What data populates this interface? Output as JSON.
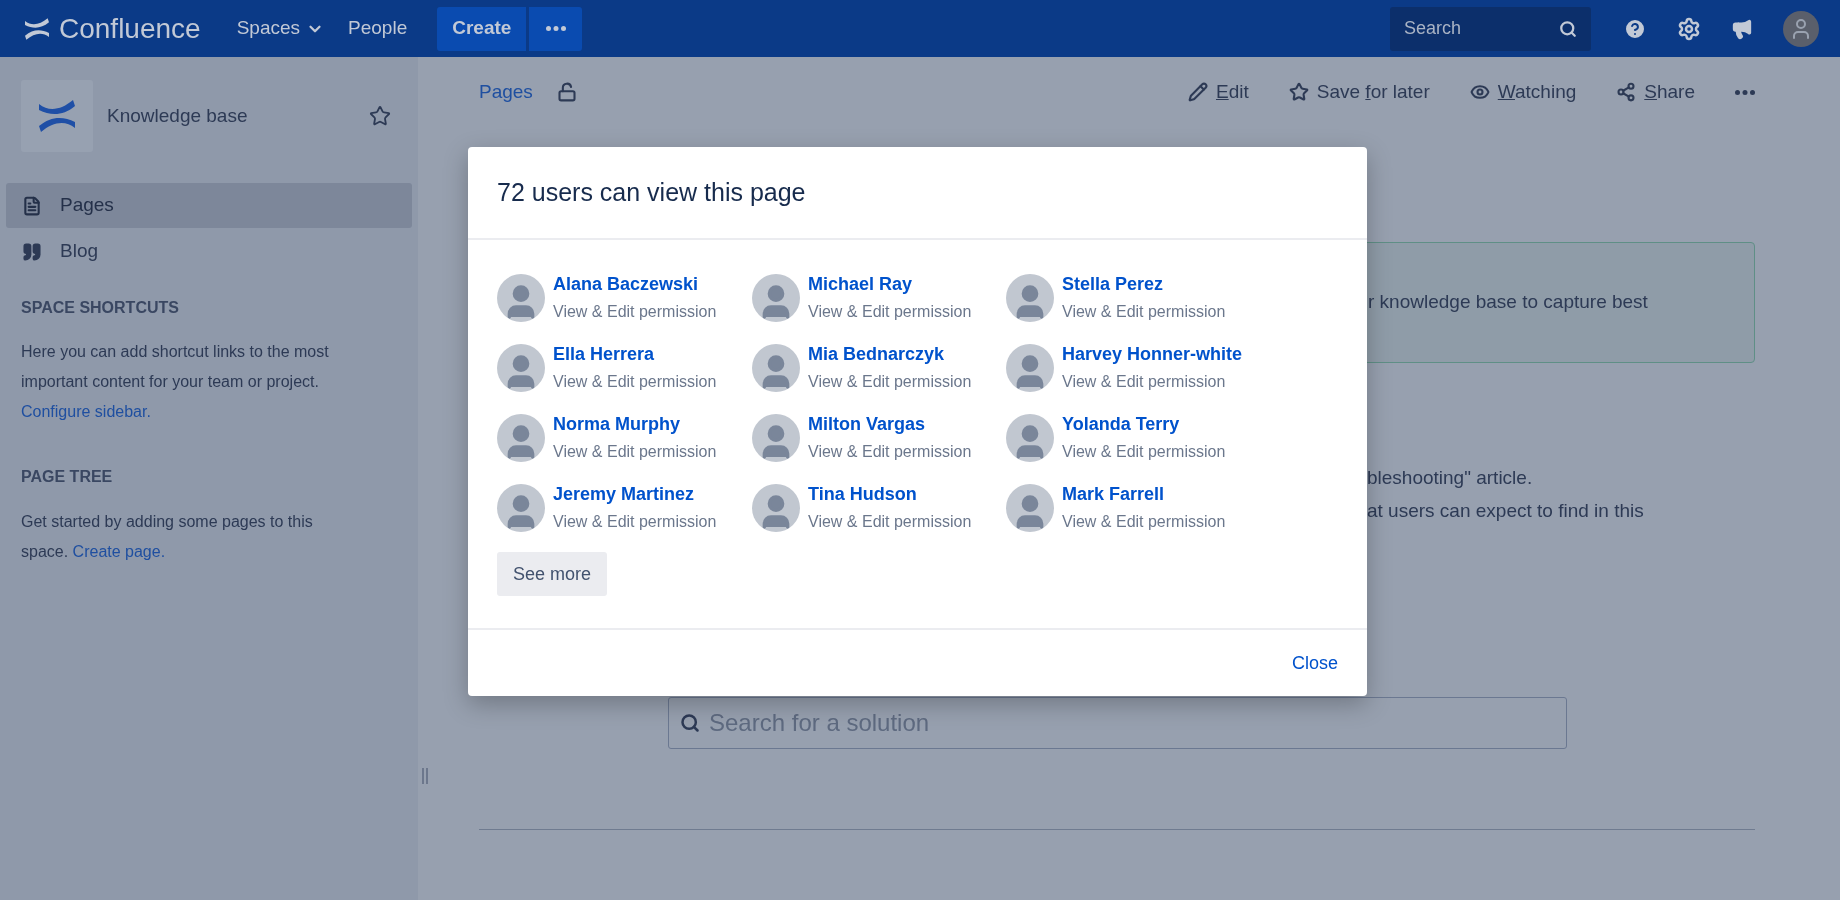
{
  "top_bar": {
    "logo_text": "Confluence",
    "nav": [
      {
        "label": "Spaces",
        "dropdown": true
      },
      {
        "label": "People",
        "dropdown": false
      }
    ],
    "create_button": "Create",
    "search": {
      "placeholder": "Search"
    }
  },
  "sidebar": {
    "space_name": "Knowledge base",
    "items": [
      {
        "label": "Pages",
        "kind": "pages",
        "selected": true
      },
      {
        "label": "Blog",
        "kind": "blog",
        "selected": false
      }
    ],
    "shortcuts": {
      "heading": "SPACE SHORTCUTS",
      "text": "Here you can add shortcut links to the most important content for your team or project.",
      "link": "Configure sidebar."
    },
    "page_tree": {
      "heading": "PAGE TREE",
      "text": "Get started by adding some pages to this space.",
      "link": "Create page."
    }
  },
  "page": {
    "breadcrumb": "Pages",
    "actions": [
      {
        "kind": "edit",
        "key": "E",
        "after": "dit"
      },
      {
        "kind": "save",
        "before": "Save ",
        "key": "f",
        "after": "or later"
      },
      {
        "kind": "watch",
        "key": "W",
        "after": "atching"
      },
      {
        "kind": "share",
        "key": "S",
        "after": "hare"
      }
    ],
    "panel_text": "r knowledge base to capture best",
    "body_lines": [
      "bleshooting\" article.",
      "at users can expect to find in this"
    ],
    "search": {
      "placeholder": "Search for a solution"
    }
  },
  "dialog": {
    "title": "72 users can view this page",
    "users": [
      {
        "name": "Alana Baczewski",
        "permission": "View & Edit permission"
      },
      {
        "name": "Michael Ray",
        "permission": "View & Edit permission"
      },
      {
        "name": "Stella Perez",
        "permission": "View & Edit permission"
      },
      {
        "name": "Ella Herrera",
        "permission": "View & Edit permission"
      },
      {
        "name": "Mia Bednarczyk",
        "permission": "View & Edit permission"
      },
      {
        "name": "Harvey Honner-white",
        "permission": "View & Edit permission"
      },
      {
        "name": "Norma Murphy",
        "permission": "View & Edit permission"
      },
      {
        "name": "Milton Vargas",
        "permission": "View & Edit permission"
      },
      {
        "name": "Yolanda Terry",
        "permission": "View & Edit permission"
      },
      {
        "name": "Jeremy Martinez",
        "permission": "View & Edit permission"
      },
      {
        "name": "Tina Hudson",
        "permission": "View & Edit permission"
      },
      {
        "name": "Mark Farrell",
        "permission": "View & Edit permission"
      }
    ],
    "see_more": "See more",
    "close": "Close"
  }
}
